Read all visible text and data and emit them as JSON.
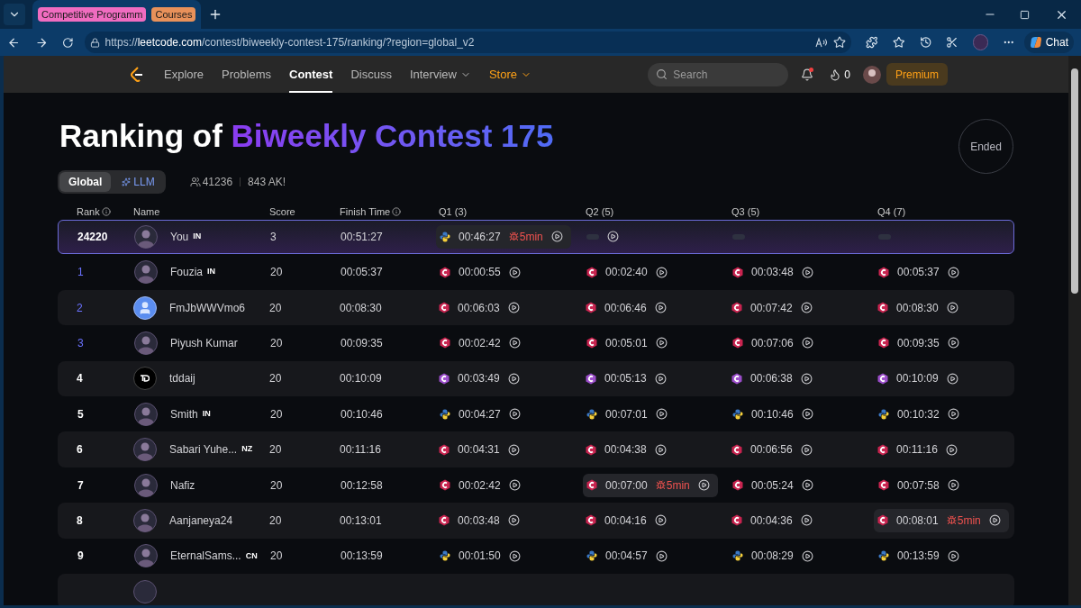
{
  "browser": {
    "tab_groups": [
      {
        "label": "Competitive Programm",
        "color": "#f06cc0"
      },
      {
        "label": "Courses",
        "color": "#e8915a"
      }
    ],
    "url": {
      "host": "leetcode.com",
      "prefix": "https://",
      "path": "/contest/biweekly-contest-175/ranking/?region=global_v2"
    },
    "chat_button": "Chat"
  },
  "nav": {
    "items": [
      {
        "label": "Explore",
        "selected": false,
        "kind": "plain"
      },
      {
        "label": "Problems",
        "selected": false,
        "kind": "plain"
      },
      {
        "label": "Contest",
        "selected": true,
        "kind": "plain"
      },
      {
        "label": "Discuss",
        "selected": false,
        "kind": "plain"
      },
      {
        "label": "Interview",
        "selected": false,
        "kind": "menu"
      },
      {
        "label": "Store",
        "selected": false,
        "kind": "store"
      }
    ],
    "search": {
      "placeholder": "Search"
    },
    "notification": true,
    "streak": "0",
    "premium": "Premium"
  },
  "title": {
    "prefix": "Ranking of ",
    "highlight": "Biweekly Contest 175"
  },
  "status": "Ended",
  "views": [
    {
      "label": "Global",
      "selected": true,
      "kind": "plain"
    },
    {
      "label": "LLM",
      "selected": false,
      "kind": "ai"
    }
  ],
  "participants": "41236",
  "ak": "843 AK!",
  "columns": [
    "Rank",
    "Name",
    "Score",
    "Finish Time",
    "Q1 (3)",
    "Q2 (5)",
    "Q3 (5)",
    "Q4 (7)"
  ],
  "rows": [
    {
      "rank": "24220",
      "name": "You",
      "country": "IN",
      "score": "3",
      "finish": "00:51:27",
      "mine": true,
      "cells": [
        {
          "kind": "python",
          "time": "00:46:27",
          "penalty": "5min",
          "replay": true
        },
        {
          "kind": "empty",
          "replay": true
        },
        {
          "kind": "empty",
          "replay": false
        },
        {
          "kind": "empty",
          "replay": false
        }
      ]
    },
    {
      "rank": "1",
      "name": "Fouzia",
      "country": "IN",
      "score": "20",
      "finish": "00:05:37",
      "mine": false,
      "cells": [
        {
          "kind": "cpp",
          "time": "00:00:55",
          "replay": true
        },
        {
          "kind": "cpp",
          "time": "00:02:40",
          "replay": true
        },
        {
          "kind": "cpp",
          "time": "00:03:48",
          "replay": true
        },
        {
          "kind": "cpp",
          "time": "00:05:37",
          "replay": true
        }
      ]
    },
    {
      "rank": "2",
      "name": "FmJbWWVmo6",
      "score": "20",
      "finish": "00:08:30",
      "mine": false,
      "avatar": {
        "kind": "default"
      },
      "cells": [
        {
          "kind": "cpp",
          "time": "00:06:03",
          "replay": true
        },
        {
          "kind": "cpp",
          "time": "00:06:46",
          "replay": true
        },
        {
          "kind": "cpp",
          "time": "00:07:42",
          "replay": true
        },
        {
          "kind": "cpp",
          "time": "00:08:30",
          "replay": true
        }
      ]
    },
    {
      "rank": "3",
      "name": "Piyush Kumar",
      "score": "20",
      "finish": "00:09:35",
      "mine": false,
      "cells": [
        {
          "kind": "cpp",
          "time": "00:02:42",
          "replay": true
        },
        {
          "kind": "cpp",
          "time": "00:05:01",
          "replay": true
        },
        {
          "kind": "cpp",
          "time": "00:07:06",
          "replay": true
        },
        {
          "kind": "cpp",
          "time": "00:09:35",
          "replay": true
        }
      ]
    },
    {
      "rank": "4",
      "name": "tddaij",
      "score": "20",
      "finish": "00:10:09",
      "mine": false,
      "avatar": {
        "kind": "logo"
      },
      "cells": [
        {
          "kind": "csharp",
          "time": "00:03:49",
          "replay": true
        },
        {
          "kind": "csharp",
          "time": "00:05:13",
          "replay": true
        },
        {
          "kind": "csharp",
          "time": "00:06:38",
          "replay": true
        },
        {
          "kind": "csharp",
          "time": "00:10:09",
          "replay": true
        }
      ]
    },
    {
      "rank": "5",
      "name": "Smith",
      "country": "IN",
      "score": "20",
      "finish": "00:10:46",
      "mine": false,
      "cells": [
        {
          "kind": "python",
          "time": "00:04:27",
          "replay": true
        },
        {
          "kind": "python",
          "time": "00:07:01",
          "replay": true
        },
        {
          "kind": "python",
          "time": "00:10:46",
          "replay": true
        },
        {
          "kind": "python",
          "time": "00:10:32",
          "replay": true
        }
      ]
    },
    {
      "rank": "6",
      "name": "Sabari Yuhe...",
      "country": "NZ",
      "score": "20",
      "finish": "00:11:16",
      "mine": false,
      "cells": [
        {
          "kind": "cpp",
          "time": "00:04:31",
          "replay": true
        },
        {
          "kind": "cpp",
          "time": "00:04:38",
          "replay": true
        },
        {
          "kind": "cpp",
          "time": "00:06:56",
          "replay": true
        },
        {
          "kind": "cpp",
          "time": "00:11:16",
          "replay": true
        }
      ]
    },
    {
      "rank": "7",
      "name": "Nafiz",
      "score": "20",
      "finish": "00:12:58",
      "mine": false,
      "cells": [
        {
          "kind": "cpp",
          "time": "00:02:42",
          "replay": true
        },
        {
          "kind": "cpp",
          "time": "00:07:00",
          "penalty": "5min",
          "replay": true
        },
        {
          "kind": "cpp",
          "time": "00:05:24",
          "replay": true
        },
        {
          "kind": "cpp",
          "time": "00:07:58",
          "replay": true
        }
      ]
    },
    {
      "rank": "8",
      "name": "Aanjaneya24",
      "score": "20",
      "finish": "00:13:01",
      "mine": false,
      "cells": [
        {
          "kind": "cpp",
          "time": "00:03:48",
          "replay": true
        },
        {
          "kind": "cpp",
          "time": "00:04:16",
          "replay": true
        },
        {
          "kind": "cpp",
          "time": "00:04:36",
          "replay": true
        },
        {
          "kind": "cpp",
          "time": "00:08:01",
          "penalty": "5min",
          "replay": true
        }
      ]
    },
    {
      "rank": "9",
      "name": "EternalSams...",
      "country": "CN",
      "score": "20",
      "finish": "00:13:59",
      "mine": false,
      "cells": [
        {
          "kind": "python",
          "time": "00:01:50",
          "replay": true
        },
        {
          "kind": "python",
          "time": "00:04:57",
          "replay": true
        },
        {
          "kind": "python",
          "time": "00:08:29",
          "replay": true
        },
        {
          "kind": "python",
          "time": "00:13:59",
          "replay": true
        }
      ]
    }
  ]
}
